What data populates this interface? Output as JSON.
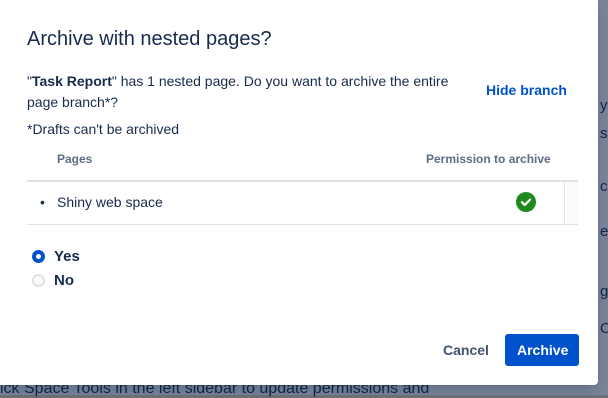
{
  "background": {
    "footer_text": "ick Space Tools in the left sidebar to update permissions and",
    "fragments": [
      "y",
      "s",
      "e",
      "c",
      "g",
      "O"
    ]
  },
  "dialog": {
    "title": "Archive with nested pages?",
    "description": {
      "quote_open": "\"",
      "page_name": "Task Report",
      "rest": "\" has 1 nested page. Do you want to archive the entire page branch*?"
    },
    "hide_branch_label": "Hide branch",
    "drafts_note": "*Drafts can't be archived",
    "table": {
      "headers": [
        "Pages",
        "Permission to archive"
      ],
      "rows": [
        {
          "bullet": "•",
          "name": "Shiny web space",
          "permission_icon": "check-circle-icon"
        }
      ]
    },
    "options": [
      {
        "label": "Yes",
        "selected": true
      },
      {
        "label": "No",
        "selected": false
      }
    ],
    "buttons": {
      "cancel": "Cancel",
      "archive": "Archive"
    }
  },
  "colors": {
    "primary": "#0052CC",
    "success": "#1E8A1E",
    "text": "#172B4D",
    "subtle": "#5E6C84"
  }
}
